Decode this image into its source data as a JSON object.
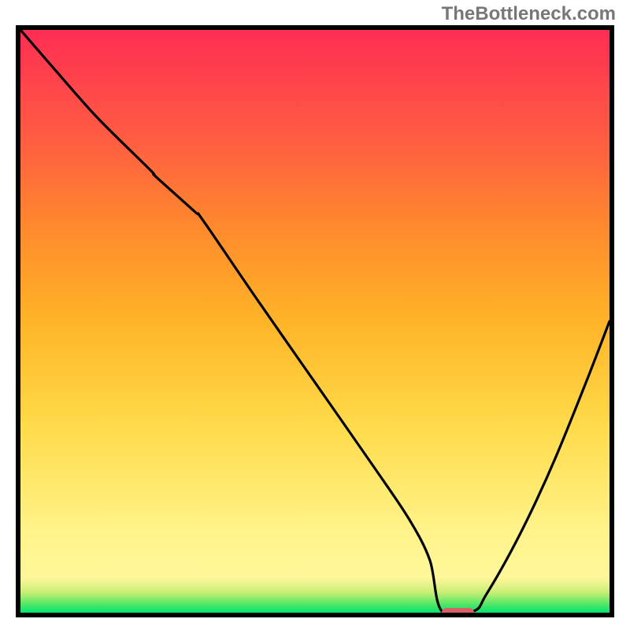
{
  "watermark": "TheBottleneck.com",
  "chart_data": {
    "type": "line",
    "title": "",
    "subtitle": "",
    "xlabel": "",
    "ylabel": "",
    "xlim": [
      0,
      1
    ],
    "ylim": [
      0,
      1
    ],
    "grid": false,
    "legend": false,
    "annotations": [],
    "background_gradient": {
      "direction": "vertical",
      "stops": [
        {
          "pos": 0.0,
          "color": "#ff2d54"
        },
        {
          "pos": 0.2,
          "color": "#ff6040"
        },
        {
          "pos": 0.34,
          "color": "#ff8a2d"
        },
        {
          "pos": 0.5,
          "color": "#ffb427"
        },
        {
          "pos": 0.68,
          "color": "#ffdb4a"
        },
        {
          "pos": 0.86,
          "color": "#fff38a"
        },
        {
          "pos": 0.94,
          "color": "#fff79a"
        },
        {
          "pos": 0.965,
          "color": "#c8ef76"
        },
        {
          "pos": 0.985,
          "color": "#55e766"
        },
        {
          "pos": 1.0,
          "color": "#00e56e"
        }
      ]
    },
    "well_marker": {
      "x_range": [
        0.715,
        0.77
      ],
      "y": 0.0,
      "color": "#d85f66"
    },
    "series": [
      {
        "name": "curve",
        "color": "#000000",
        "x": [
          0.0,
          0.06,
          0.13,
          0.22,
          0.23,
          0.296,
          0.31,
          0.4,
          0.5,
          0.6,
          0.66,
          0.695,
          0.715,
          0.77,
          0.79,
          0.83,
          0.87,
          0.91,
          0.96,
          1.0
        ],
        "values": [
          1.0,
          0.93,
          0.85,
          0.76,
          0.748,
          0.688,
          0.673,
          0.54,
          0.395,
          0.25,
          0.16,
          0.09,
          0.003,
          0.003,
          0.03,
          0.1,
          0.18,
          0.27,
          0.395,
          0.5
        ]
      }
    ]
  }
}
